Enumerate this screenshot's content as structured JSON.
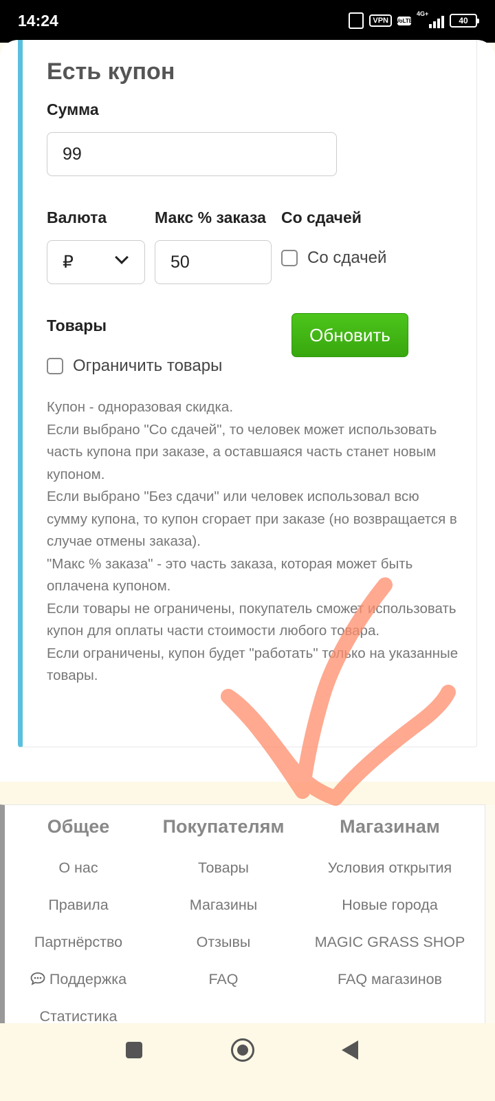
{
  "status_bar": {
    "time": "14:24",
    "vpn": "VPN",
    "lte_top": "Vo",
    "lte_bottom": "LTE",
    "network": "4G+",
    "battery": "40"
  },
  "coupon": {
    "title": "Есть купон",
    "amount_label": "Сумма",
    "amount_value": "99",
    "currency_label": "Валюта",
    "currency_value": "₽",
    "max_percent_label": "Макс % заказа",
    "max_percent_value": "50",
    "change_label": "Со сдачей",
    "change_checkbox_label": "Со сдачей",
    "change_checked": false,
    "goods_label": "Товары",
    "limit_goods_label": "Ограничить товары",
    "limit_goods_checked": false,
    "update_button": "Обновить",
    "help_lines": [
      "Купон - одноразовая скидка.",
      "Если выбрано \"Со сдачей\", то человек может использовать часть купона при заказе, а оставшаяся часть станет новым купоном.",
      "Если выбрано \"Без сдачи\" или человек использовал всю сумму купона, то купон сгорает при заказе (но возвращается в случае отмены заказа).",
      "\"Макс % заказа\" - это часть заказа, которая может быть оплачена купоном.",
      "Если товары не ограничены, покупатель сможет использовать купон для оплаты части стоимости любого товара.",
      "Если ограничены, купон будет \"работать\" только на указанные товары."
    ]
  },
  "footer": {
    "columns": [
      {
        "title": "Общее",
        "links": [
          "О нас",
          "Правила",
          "Партнёрство",
          "Поддержка",
          "Статистика"
        ]
      },
      {
        "title": "Покупателям",
        "links": [
          "Товары",
          "Магазины",
          "Отзывы",
          "FAQ"
        ]
      },
      {
        "title": "Магазинам",
        "links": [
          "Условия открытия",
          "Новые города",
          "MAGIC GRASS SHOP",
          "FAQ магазинов"
        ]
      }
    ]
  },
  "colors": {
    "card_accent": "#5bc0de",
    "button_green": "#3fb514",
    "annotation_stroke": "#ff8c6b"
  },
  "icons": [
    "rotate-icon",
    "vpn-icon",
    "volte-icon",
    "signal-icon",
    "battery-icon",
    "chevron-down-icon",
    "chat-icon",
    "recents-icon",
    "home-icon",
    "back-icon"
  ]
}
